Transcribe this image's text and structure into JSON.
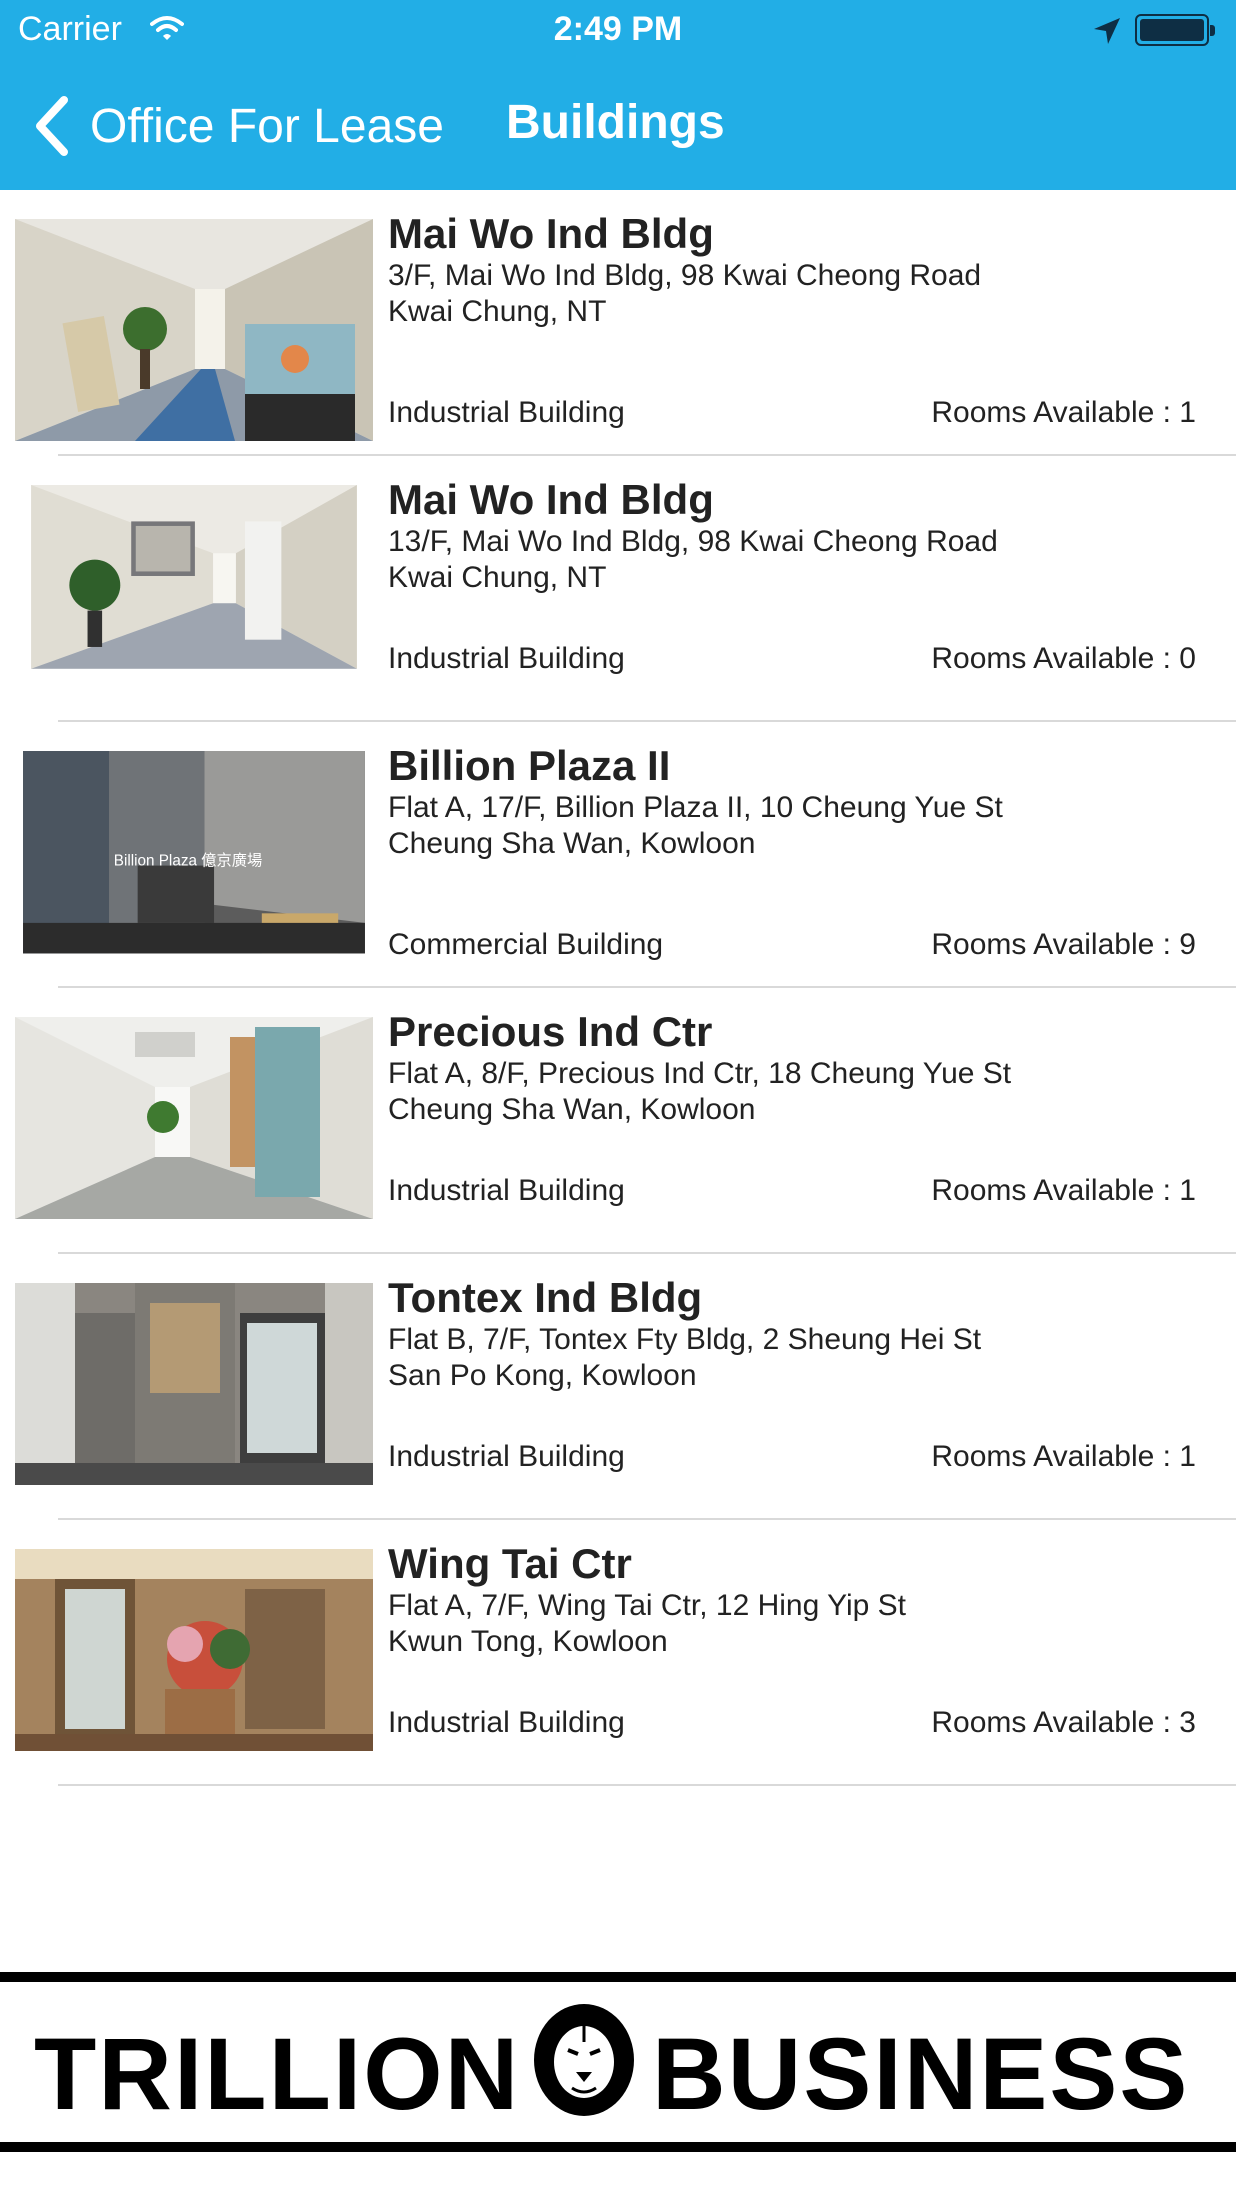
{
  "status_bar": {
    "carrier": "Carrier",
    "time": "2:49 PM"
  },
  "nav": {
    "back_label": "Office For Lease",
    "title": "Buildings"
  },
  "buildings": [
    {
      "name": "Mai Wo Ind Bldg",
      "address_line1": "3/F, Mai Wo Ind Bldg, 98 Kwai Cheong Road",
      "address_line2": "Kwai Chung, NT",
      "type": "Industrial Building",
      "rooms": "Rooms Available : 1"
    },
    {
      "name": "Mai Wo Ind Bldg",
      "address_line1": "13/F, Mai Wo Ind Bldg, 98 Kwai Cheong Road",
      "address_line2": "Kwai Chung, NT",
      "type": "Industrial Building",
      "rooms": "Rooms Available : 0"
    },
    {
      "name": "Billion Plaza II",
      "address_line1": "Flat A, 17/F, Billion Plaza II, 10 Cheung Yue St",
      "address_line2": "Cheung Sha Wan, Kowloon",
      "type": "Commercial Building",
      "rooms": "Rooms Available : 9",
      "photo_sign": "Billion Plaza 億京廣場"
    },
    {
      "name": "Precious Ind Ctr",
      "address_line1": "Flat A, 8/F, Precious Ind Ctr, 18 Cheung Yue St",
      "address_line2": "Cheung Sha Wan, Kowloon",
      "type": "Industrial Building",
      "rooms": "Rooms Available : 1"
    },
    {
      "name": "Tontex Ind Bldg",
      "address_line1": "Flat B, 7/F, Tontex Fty Bldg, 2 Sheung Hei St",
      "address_line2": "San Po Kong, Kowloon",
      "type": "Industrial Building",
      "rooms": "Rooms Available : 1"
    },
    {
      "name": "Wing Tai Ctr",
      "address_line1": "Flat A, 7/F, Wing Tai Ctr, 12 Hing Yip St",
      "address_line2": "Kwun Tong, Kowloon",
      "type": "Industrial Building",
      "rooms": "Rooms Available : 3"
    }
  ],
  "brand": {
    "word1": "TRILLION",
    "word2": "BUSINESS"
  },
  "colors": {
    "nav_bar": "#22aee6",
    "text": "#222222",
    "separator": "#d9d9d9"
  }
}
